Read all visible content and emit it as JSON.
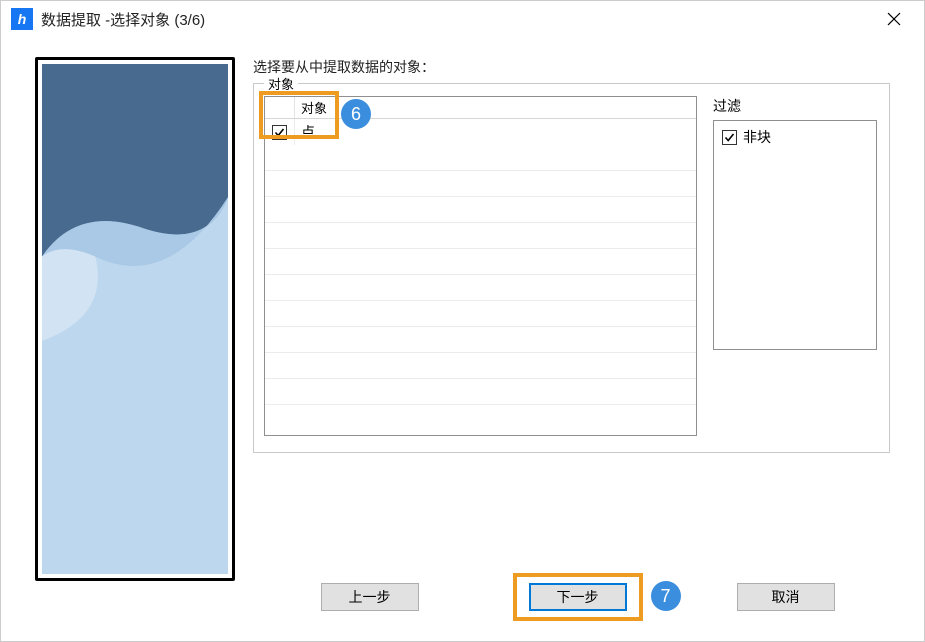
{
  "titlebar": {
    "icon_text": "h",
    "title": "数据提取 -选择对象 (3/6)"
  },
  "prompt": "选择要从中提取数据的对象：",
  "group_label": "对象",
  "objects": {
    "header_label": "对象",
    "rows": [
      {
        "checked": true,
        "label": "点"
      }
    ]
  },
  "filter": {
    "label": "过滤",
    "rows": [
      {
        "checked": true,
        "label": "非块"
      }
    ]
  },
  "buttons": {
    "back": "上一步",
    "next": "下一步",
    "cancel": "取消"
  },
  "annotations": {
    "badge6": "6",
    "badge7": "7"
  }
}
